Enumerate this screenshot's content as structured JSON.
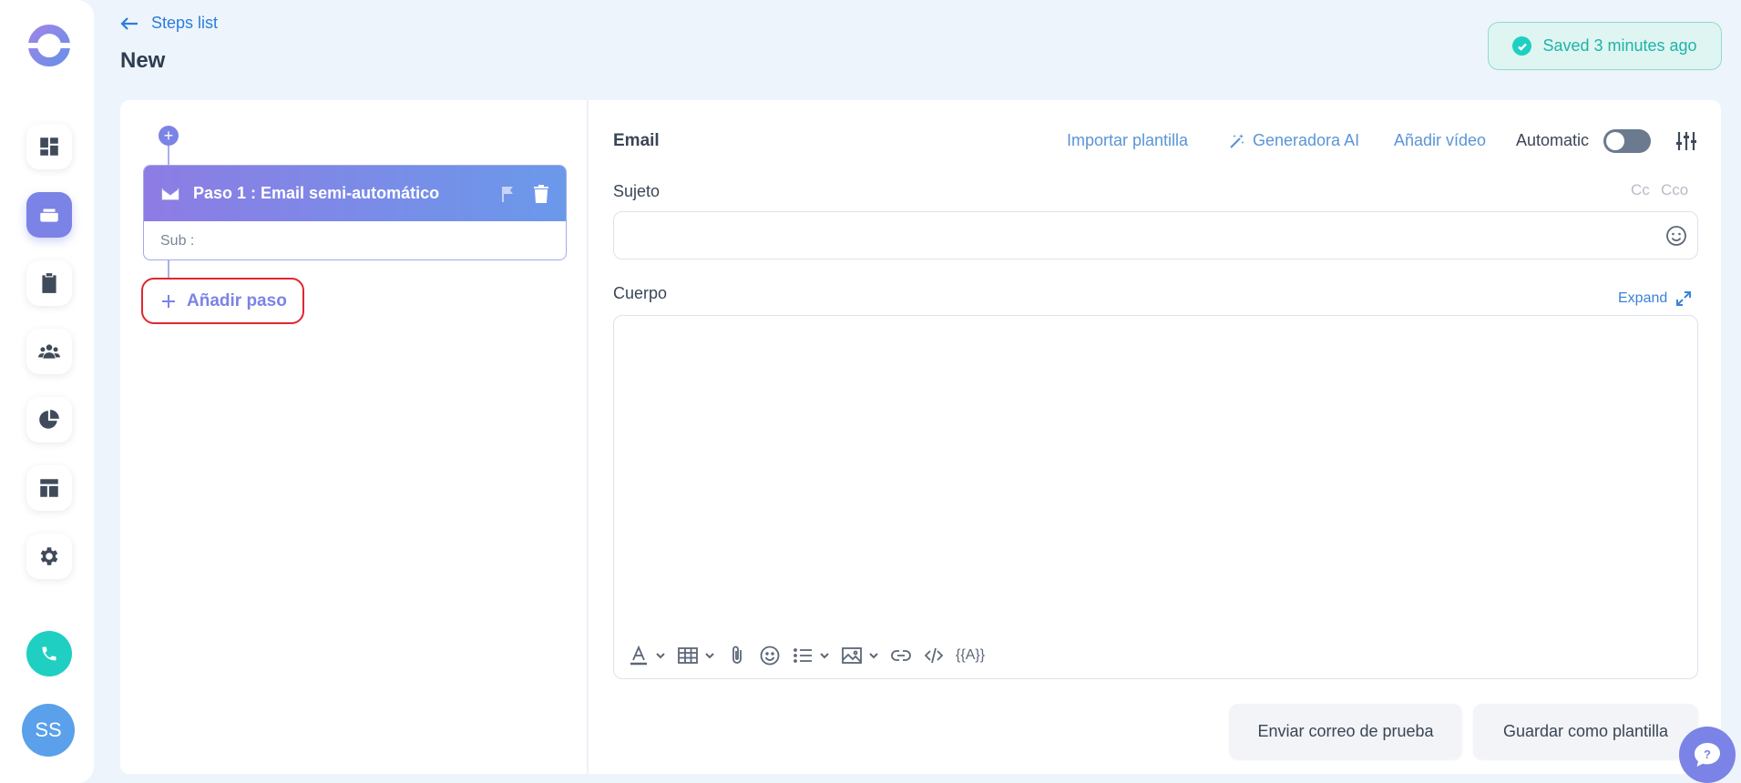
{
  "header": {
    "back_label": "Steps list",
    "page_title": "New",
    "saved_status": "Saved 3 minutes ago"
  },
  "sidebar": {
    "items": [
      {
        "icon": "dashboard-icon",
        "active": false
      },
      {
        "icon": "sequences-icon",
        "active": true
      },
      {
        "icon": "clipboard-icon",
        "active": false
      },
      {
        "icon": "contacts-icon",
        "active": false
      },
      {
        "icon": "reports-icon",
        "active": false
      },
      {
        "icon": "templates-icon",
        "active": false
      },
      {
        "icon": "settings-icon",
        "active": false
      }
    ],
    "avatar_initials": "SS"
  },
  "steps": {
    "step1_title": "Paso 1 : Email semi-automático",
    "step1_sub": "Sub :",
    "add_step_label": "Añadir paso"
  },
  "editor": {
    "title": "Email",
    "import_template": "Importar plantilla",
    "ai_generator": "Generadora AI",
    "add_video": "Añadir vídeo",
    "automatic_label": "Automatic",
    "automatic_on": false,
    "subject_label": "Sujeto",
    "cc_label": "Cc",
    "bcc_label": "Cco",
    "subject_value": "",
    "body_label": "Cuerpo",
    "expand_label": "Expand",
    "variables_label": "{{A}}",
    "send_test_label": "Enviar correo de prueba",
    "save_template_label": "Guardar como plantilla"
  },
  "colors": {
    "accent": "#7b83e6",
    "link": "#2a7ddc",
    "success": "#1fcfc2",
    "highlight_border": "#e0262f"
  }
}
